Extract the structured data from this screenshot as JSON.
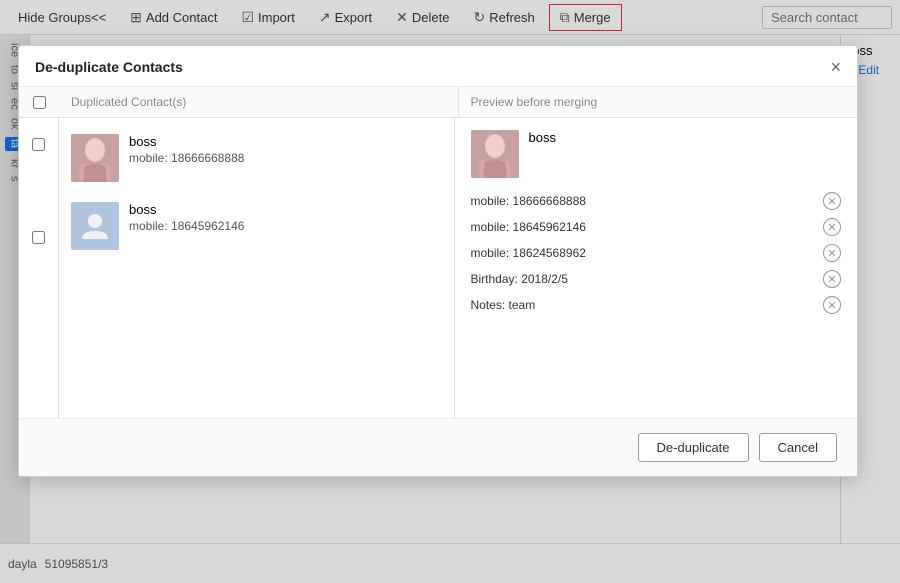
{
  "toolbar": {
    "hide_groups_label": "Hide Groups<<",
    "add_contact_label": "Add Contact",
    "import_label": "Import",
    "export_label": "Export",
    "delete_label": "Delete",
    "refresh_label": "Refresh",
    "merge_label": "Merge",
    "search_placeholder": "Search contact"
  },
  "dialog": {
    "title": "De-duplicate Contacts",
    "col_duplicated": "Duplicated Contact(s)",
    "col_preview": "Preview before merging",
    "close_icon": "×",
    "contacts": [
      {
        "name": "boss",
        "detail": "mobile: 18666668888",
        "has_photo": true
      },
      {
        "name": "boss",
        "detail": "mobile: 18645962146",
        "has_photo": false
      }
    ],
    "preview": {
      "name": "boss",
      "fields": [
        "mobile: 18666668888",
        "mobile: 18645962146",
        "mobile: 18624568962",
        "Birthday: 2018/2/5",
        "Notes: team"
      ]
    },
    "footer": {
      "deduplicate_label": "De-duplicate",
      "cancel_label": "Cancel"
    }
  },
  "sidebar": {
    "items": [
      "ice",
      "to",
      "si",
      "ec",
      "ok",
      "ta",
      "kr",
      "s"
    ]
  },
  "right_panel": {
    "name": "boss",
    "edit_label": "✎ Edit"
  },
  "bottom_strip": {
    "name": "dayla",
    "phone": "51095851/3"
  }
}
